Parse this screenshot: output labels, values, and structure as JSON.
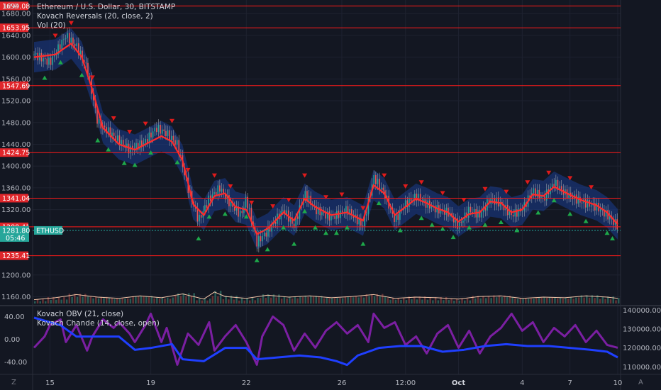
{
  "chart_data": {
    "type": "candlestick",
    "title": "Ethereum / U.S. Dollar, 30, BITSTAMP",
    "symbol": "ETHUSD",
    "currency": "USD",
    "indicators_main": [
      "Kovach Reversals (20, close, 2)",
      "Vol (20)"
    ],
    "indicators_sub": [
      "Kovach OBV (21, close)",
      "Kovach Chande (14, close, open)"
    ],
    "last_price": "1281.80",
    "countdown": "05:46",
    "price_axis_labels": [
      "1680.00",
      "1640.00",
      "1600.00",
      "1560.00",
      "1520.00",
      "1480.00",
      "1440.00",
      "1400.00",
      "1360.00",
      "1320.00",
      "1200.00",
      "1160.00"
    ],
    "price_ylim": [
      1145,
      1705
    ],
    "levels": [
      {
        "label": "1694.08",
        "value": 1694.08
      },
      {
        "label": "1653.95",
        "value": 1653.95
      },
      {
        "label": "1547.69",
        "value": 1547.69
      },
      {
        "label": "1424.75",
        "value": 1424.75
      },
      {
        "label": "1341.04",
        "value": 1341.04
      },
      {
        "label": "1288.41",
        "value": 1288.41
      },
      {
        "label": "1235.41",
        "value": 1235.41
      }
    ],
    "x_ticks": [
      "15",
      "19",
      "22",
      "26",
      "12:00",
      "Oct",
      "4",
      "7",
      "10"
    ],
    "price_path": [
      [
        0,
        1605
      ],
      [
        3,
        1590
      ],
      [
        6,
        1640
      ],
      [
        8,
        1620
      ],
      [
        10,
        1580
      ],
      [
        12,
        1480
      ],
      [
        15,
        1455
      ],
      [
        18,
        1430
      ],
      [
        21,
        1445
      ],
      [
        23,
        1470
      ],
      [
        25,
        1460
      ],
      [
        27,
        1440
      ],
      [
        29,
        1360
      ],
      [
        31,
        1300
      ],
      [
        33,
        1340
      ],
      [
        35,
        1360
      ],
      [
        37,
        1330
      ],
      [
        39,
        1310
      ],
      [
        40,
        1340
      ],
      [
        42,
        1260
      ],
      [
        44,
        1280
      ],
      [
        47,
        1320
      ],
      [
        49,
        1290
      ],
      [
        51,
        1350
      ],
      [
        53,
        1320
      ],
      [
        56,
        1305
      ],
      [
        59,
        1320
      ],
      [
        62,
        1290
      ],
      [
        64,
        1380
      ],
      [
        66,
        1350
      ],
      [
        68,
        1300
      ],
      [
        70,
        1330
      ],
      [
        72,
        1345
      ],
      [
        74,
        1330
      ],
      [
        76,
        1320
      ],
      [
        78,
        1315
      ],
      [
        80,
        1290
      ],
      [
        82,
        1320
      ],
      [
        84,
        1310
      ],
      [
        86,
        1340
      ],
      [
        88,
        1330
      ],
      [
        90,
        1310
      ],
      [
        92,
        1320
      ],
      [
        94,
        1355
      ],
      [
        96,
        1340
      ],
      [
        98,
        1370
      ],
      [
        100,
        1350
      ],
      [
        103,
        1335
      ],
      [
        106,
        1325
      ],
      [
        108,
        1310
      ],
      [
        110,
        1290
      ]
    ],
    "kovach_line": [
      [
        0,
        1600
      ],
      [
        4,
        1605
      ],
      [
        7,
        1625
      ],
      [
        9,
        1600
      ],
      [
        11,
        1540
      ],
      [
        13,
        1470
      ],
      [
        16,
        1440
      ],
      [
        19,
        1430
      ],
      [
        22,
        1445
      ],
      [
        24,
        1455
      ],
      [
        26,
        1445
      ],
      [
        28,
        1410
      ],
      [
        30,
        1330
      ],
      [
        32,
        1310
      ],
      [
        34,
        1345
      ],
      [
        36,
        1350
      ],
      [
        38,
        1325
      ],
      [
        40,
        1320
      ],
      [
        42,
        1275
      ],
      [
        44,
        1285
      ],
      [
        47,
        1315
      ],
      [
        49,
        1300
      ],
      [
        51,
        1340
      ],
      [
        53,
        1325
      ],
      [
        56,
        1310
      ],
      [
        59,
        1315
      ],
      [
        62,
        1300
      ],
      [
        64,
        1365
      ],
      [
        66,
        1350
      ],
      [
        68,
        1310
      ],
      [
        70,
        1325
      ],
      [
        72,
        1340
      ],
      [
        74,
        1332
      ],
      [
        76,
        1322
      ],
      [
        78,
        1315
      ],
      [
        80,
        1298
      ],
      [
        82,
        1312
      ],
      [
        84,
        1315
      ],
      [
        86,
        1335
      ],
      [
        88,
        1332
      ],
      [
        90,
        1315
      ],
      [
        92,
        1320
      ],
      [
        94,
        1348
      ],
      [
        96,
        1345
      ],
      [
        98,
        1362
      ],
      [
        100,
        1352
      ],
      [
        103,
        1338
      ],
      [
        106,
        1328
      ],
      [
        108,
        1315
      ],
      [
        110,
        1293
      ]
    ],
    "oscillator_axis_labels": [
      "40.00",
      "0.00",
      "-40.00"
    ],
    "oscillator_ylim": [
      -62,
      58
    ],
    "obv_axis_labels": [
      "140000.00",
      "130000.00",
      "120000.00",
      "110000.00"
    ],
    "obv_ylim": [
      106000,
      142000
    ],
    "chande_values": [
      [
        0,
        -15
      ],
      [
        2,
        5
      ],
      [
        3,
        25
      ],
      [
        5,
        35
      ],
      [
        6,
        -5
      ],
      [
        8,
        25
      ],
      [
        10,
        -20
      ],
      [
        11,
        5
      ],
      [
        13,
        35
      ],
      [
        15,
        20
      ],
      [
        16,
        30
      ],
      [
        18,
        10
      ],
      [
        19,
        -5
      ],
      [
        21,
        25
      ],
      [
        22,
        45
      ],
      [
        24,
        -5
      ],
      [
        25,
        20
      ],
      [
        27,
        -45
      ],
      [
        29,
        10
      ],
      [
        31,
        -10
      ],
      [
        33,
        30
      ],
      [
        34,
        -20
      ],
      [
        36,
        5
      ],
      [
        38,
        25
      ],
      [
        40,
        -5
      ],
      [
        42,
        -45
      ],
      [
        43,
        5
      ],
      [
        45,
        40
      ],
      [
        47,
        25
      ],
      [
        49,
        -20
      ],
      [
        51,
        10
      ],
      [
        53,
        -15
      ],
      [
        55,
        15
      ],
      [
        57,
        30
      ],
      [
        59,
        10
      ],
      [
        61,
        25
      ],
      [
        63,
        -5
      ],
      [
        64,
        45
      ],
      [
        66,
        20
      ],
      [
        68,
        30
      ],
      [
        70,
        -10
      ],
      [
        72,
        5
      ],
      [
        74,
        -25
      ],
      [
        76,
        10
      ],
      [
        78,
        25
      ],
      [
        80,
        -15
      ],
      [
        82,
        15
      ],
      [
        84,
        -25
      ],
      [
        86,
        5
      ],
      [
        88,
        20
      ],
      [
        90,
        45
      ],
      [
        92,
        15
      ],
      [
        94,
        30
      ],
      [
        96,
        -5
      ],
      [
        98,
        20
      ],
      [
        100,
        5
      ],
      [
        102,
        25
      ],
      [
        104,
        -5
      ],
      [
        106,
        15
      ],
      [
        108,
        -10
      ],
      [
        110,
        -15
      ]
    ],
    "obv_values": [
      [
        0,
        136000
      ],
      [
        5,
        132000
      ],
      [
        8,
        126000
      ],
      [
        12,
        126000
      ],
      [
        16,
        126000
      ],
      [
        19,
        119000
      ],
      [
        22,
        120000
      ],
      [
        26,
        122000
      ],
      [
        28,
        114000
      ],
      [
        32,
        113000
      ],
      [
        36,
        120000
      ],
      [
        40,
        120000
      ],
      [
        42,
        114000
      ],
      [
        46,
        115000
      ],
      [
        50,
        116000
      ],
      [
        54,
        115000
      ],
      [
        57,
        113000
      ],
      [
        59,
        111000
      ],
      [
        61,
        116000
      ],
      [
        65,
        120000
      ],
      [
        69,
        121000
      ],
      [
        73,
        121000
      ],
      [
        77,
        118000
      ],
      [
        81,
        119000
      ],
      [
        85,
        121000
      ],
      [
        89,
        122000
      ],
      [
        93,
        121000
      ],
      [
        97,
        121000
      ],
      [
        101,
        120000
      ],
      [
        105,
        119000
      ],
      [
        108,
        118000
      ],
      [
        110,
        115000
      ]
    ],
    "up_arrows_x": [
      2,
      5,
      9,
      12,
      14,
      17,
      19,
      22,
      27,
      31,
      33,
      36,
      40,
      42,
      44,
      47,
      49,
      51,
      53,
      55,
      57,
      59,
      62,
      65,
      69,
      73,
      75,
      77,
      79,
      82,
      85,
      88,
      91,
      95,
      98,
      101,
      104,
      108,
      109
    ],
    "down_arrows_x": [
      4,
      7,
      11,
      15,
      18,
      21,
      26,
      29,
      34,
      37,
      41,
      45,
      48,
      51,
      55,
      58,
      62,
      66,
      70,
      73,
      77,
      81,
      85,
      89,
      93,
      97,
      101,
      105
    ],
    "volume": [
      [
        0,
        6
      ],
      [
        4,
        9
      ],
      [
        8,
        14
      ],
      [
        12,
        10
      ],
      [
        16,
        8
      ],
      [
        20,
        12
      ],
      [
        24,
        9
      ],
      [
        28,
        15
      ],
      [
        32,
        7
      ],
      [
        34,
        18
      ],
      [
        36,
        11
      ],
      [
        40,
        8
      ],
      [
        44,
        13
      ],
      [
        48,
        10
      ],
      [
        52,
        12
      ],
      [
        56,
        9
      ],
      [
        60,
        11
      ],
      [
        64,
        14
      ],
      [
        68,
        8
      ],
      [
        72,
        10
      ],
      [
        76,
        9
      ],
      [
        80,
        7
      ],
      [
        84,
        11
      ],
      [
        88,
        12
      ],
      [
        92,
        8
      ],
      [
        96,
        10
      ],
      [
        100,
        9
      ],
      [
        104,
        12
      ],
      [
        108,
        10
      ],
      [
        110,
        8
      ]
    ]
  },
  "ui": {
    "currency_label": "USD",
    "goto_icon_label": "Z",
    "auto_scale_label": "A",
    "accent_red": "#e53935",
    "accent_green": "#26a69a",
    "kovach_red": "#ff2b2b",
    "obv_blue": "#1f3fff",
    "chande_purple": "#7b1fa2"
  }
}
